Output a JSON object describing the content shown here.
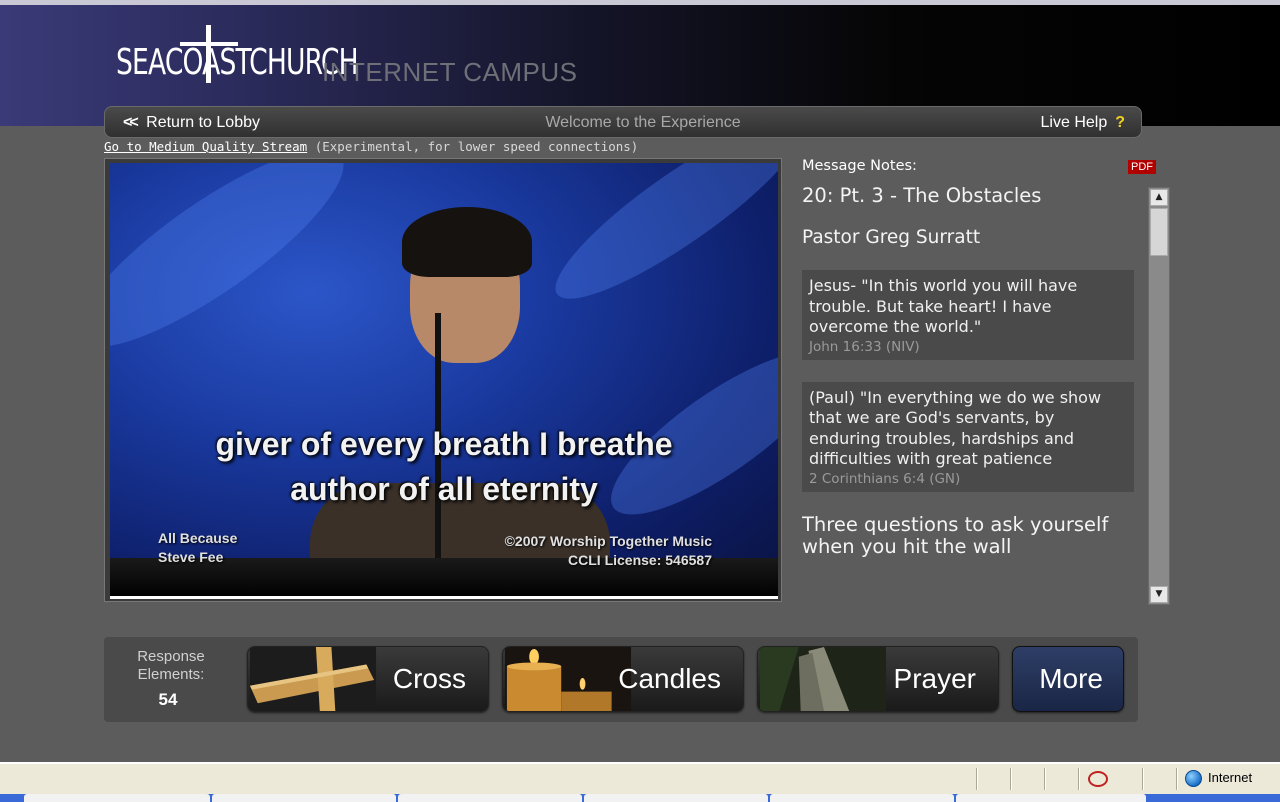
{
  "header": {
    "logo_text": "SEACOASTCHURCH",
    "campus_title": "INTERNET CAMPUS"
  },
  "nav": {
    "back_arrows": "<<",
    "back_label": "Return to Lobby",
    "welcome": "Welcome to the Experience",
    "help_label": "Live Help",
    "help_icon": "?"
  },
  "stream": {
    "link_label": "Go to Medium Quality Stream",
    "note": "(Experimental, for lower speed connections)"
  },
  "video": {
    "lyric_line1": "giver of every breath I breathe",
    "lyric_line2": "author of all eternity",
    "song_title": "All Because",
    "song_artist": "Steve Fee",
    "copyright": "©2007 Worship Together Music",
    "ccli": "CCLI License: 546587"
  },
  "notes": {
    "label": "Message Notes:",
    "pdf_label": "PDF",
    "title": "20: Pt. 3 - The Obstacles",
    "pastor": "Pastor Greg Surratt",
    "quotes": [
      {
        "text": "Jesus- \"In this world you will have trouble. But take heart! I have overcome the world.\"",
        "ref": "John 16:33 (NIV)"
      },
      {
        "text": "(Paul) \"In everything we do we show that we are God's servants, by enduring troubles, hardships and difficulties with great patience",
        "ref": "2 Corinthians 6:4 (GN)"
      }
    ],
    "heading": "Three questions to ask yourself when you hit the wall"
  },
  "response": {
    "label": "Response Elements:",
    "count": "54",
    "buttons": {
      "cross": "Cross",
      "candles": "Candles",
      "prayer": "Prayer",
      "more": "More"
    }
  },
  "statusbar": {
    "zone": "Internet"
  },
  "colors": {
    "background": "#5c5c5c",
    "pdf_red": "#b00000",
    "help_yellow": "#f0d020",
    "more_blue": "#2e3e66"
  }
}
